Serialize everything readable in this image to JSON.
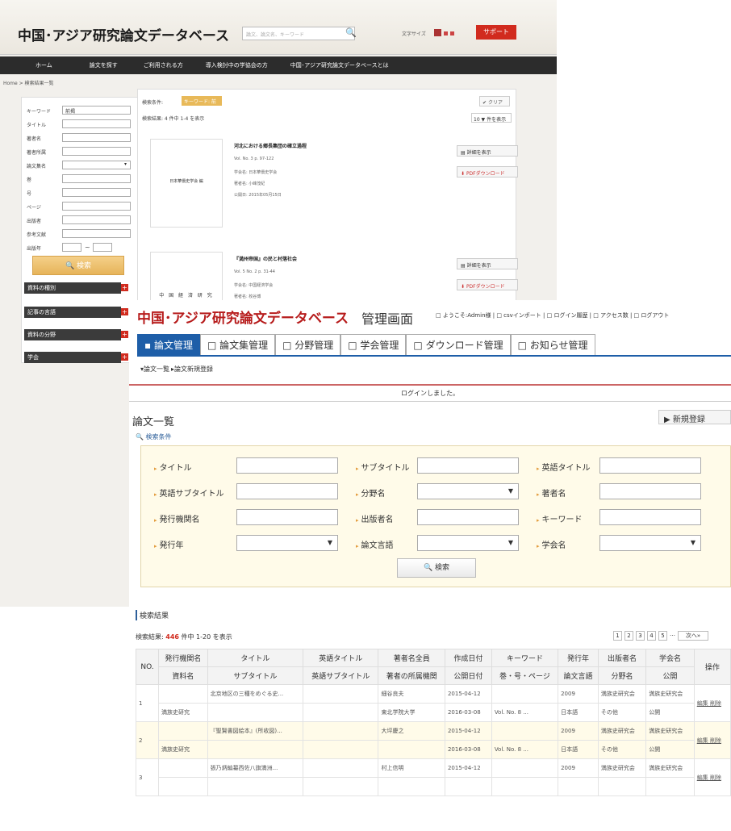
{
  "back": {
    "title": "中国･アジア研究論文データベース",
    "search_placeholder": "論文、論文名、キーワード",
    "font_size_label": "文字サイズ",
    "support_label": "サポート",
    "nav": [
      "ホーム",
      "論文を探す",
      "ご利用される方",
      "導入検討中の学協会の方",
      "中国･アジア研究論文データベースとは"
    ],
    "breadcrumb": "Home > 検索結果一覧",
    "filters": [
      {
        "label": "キーワード",
        "value": "前揭"
      },
      {
        "label": "タイトル",
        "value": ""
      },
      {
        "label": "著者名",
        "value": ""
      },
      {
        "label": "著者所属",
        "value": ""
      },
      {
        "label": "論文集名",
        "value": ""
      },
      {
        "label": "巻",
        "value": ""
      },
      {
        "label": "号",
        "value": ""
      },
      {
        "label": "ページ",
        "value": ""
      },
      {
        "label": "出版者",
        "value": ""
      },
      {
        "label": "参考文献",
        "value": ""
      },
      {
        "label": "出版年",
        "value": ""
      }
    ],
    "search_button": "検索",
    "categories": [
      "資料の種別",
      "記事の言語",
      "資料の分野",
      "学会"
    ],
    "condition_label": "検索条件:",
    "condition_tag": "キーワード: 前揭 ✕",
    "clear_label": "クリア",
    "result_count": "検索結果: 4 件中 1-4 を表示",
    "per_page": "10 ▼ 件を表示",
    "detail_label": "詳細を表示",
    "pdf_label": "PDFダウンロード",
    "papers": [
      {
        "thumb": "日本華僑史学会 編",
        "title": "河北における郷長集団の確立過程",
        "vol": "Vol. No. 3 p. 97-122",
        "society": "学会名: 日本華僑史学会",
        "author": "著者名: 小峰茂紀",
        "date": "公開日: 2015年05月15日"
      },
      {
        "thumb": "中 国 経 済 研 究",
        "title": "『満州帝国』の民と村落社会",
        "vol": "Vol. 5 No. 2 p. 31-44",
        "society": "学会名: 中国経済学会",
        "author": "著者名: 枚谷博",
        "date": ""
      }
    ]
  },
  "front": {
    "title": "中国･アジア研究論文データベース",
    "title_suffix": "管理画面",
    "header_links": "□ ようこそ:Admin様 | □ csvインポート | □ ログイン履歴 | □ アクセス数 | □ ログアウト",
    "tabs": [
      "▪ 論文管理",
      "□ 論文集管理",
      "□ 分野管理",
      "□ 学会管理",
      "□ ダウンロード管理",
      "□ お知らせ管理"
    ],
    "sub_nav_1": "▾論文一覧",
    "sub_nav_2": "▸論文新規登録",
    "message": "ログインしました。",
    "list_title": "論文一覧",
    "new_button": "▶ 新規登録",
    "condition_label": "検索条件",
    "fields": {
      "title": "タイトル",
      "subtitle": "サブタイトル",
      "en_title": "英語タイトル",
      "en_subtitle": "英語サブタイトル",
      "field_name": "分野名",
      "author": "著者名",
      "publisher_org": "発行機関名",
      "publisher": "出版者名",
      "keyword": "キーワード",
      "year": "発行年",
      "language": "論文言語",
      "society": "学会名"
    },
    "search_button": "検索",
    "results_title": "検索結果",
    "result_prefix": "検索結果:",
    "result_count": "446",
    "result_suffix": "件中 1-20 を表示",
    "pager": [
      "1",
      "2",
      "3",
      "4",
      "5",
      "…",
      "次へ»"
    ],
    "header_row1": [
      "NO.",
      "発行機関名",
      "タイトル",
      "英語タイトル",
      "著者名全員",
      "作成日付",
      "キーワード",
      "発行年",
      "出版者名",
      "学会名",
      "操作"
    ],
    "header_row2": [
      "資料名",
      "サブタイトル",
      "英語サブタイトル",
      "著者の所属機関",
      "公開日付",
      "巻・号・ページ",
      "論文言語",
      "分野名",
      "公開"
    ],
    "rows": [
      {
        "no": "1",
        "a": [
          "",
          "北京地区の三種をめぐる史...",
          "",
          "細谷良夫",
          "2015-04-12",
          "",
          "2009",
          "満族史研究会",
          "満族史研究会"
        ],
        "b": [
          "満族史研究",
          "",
          "",
          "東北学院大学",
          "2016-03-08",
          "Vol. No. 8 ...",
          "日本語",
          "その他",
          "公開"
        ],
        "ops": "編集 削除"
      },
      {
        "no": "2",
        "a": [
          "",
          "『聖賢書図絵本』(所收図)...",
          "",
          "大坪慶之",
          "2015-04-12",
          "",
          "2009",
          "満族史研究会",
          "満族史研究会"
        ],
        "b": [
          "満族史研究",
          "",
          "",
          "",
          "2016-03-08",
          "Vol. No. 8 ...",
          "日本語",
          "その他",
          "公開"
        ],
        "ops": "編集 削除"
      },
      {
        "no": "3",
        "a": [
          "",
          "張乃炳編纂西佐八旗満洲...",
          "",
          "村上信明",
          "2015-04-12",
          "",
          "2009",
          "満族史研究会",
          "満族史研究会"
        ],
        "b": [
          "",
          "",
          "",
          "",
          "",
          "",
          "",
          "",
          ""
        ],
        "ops": "編集 削除"
      }
    ]
  }
}
